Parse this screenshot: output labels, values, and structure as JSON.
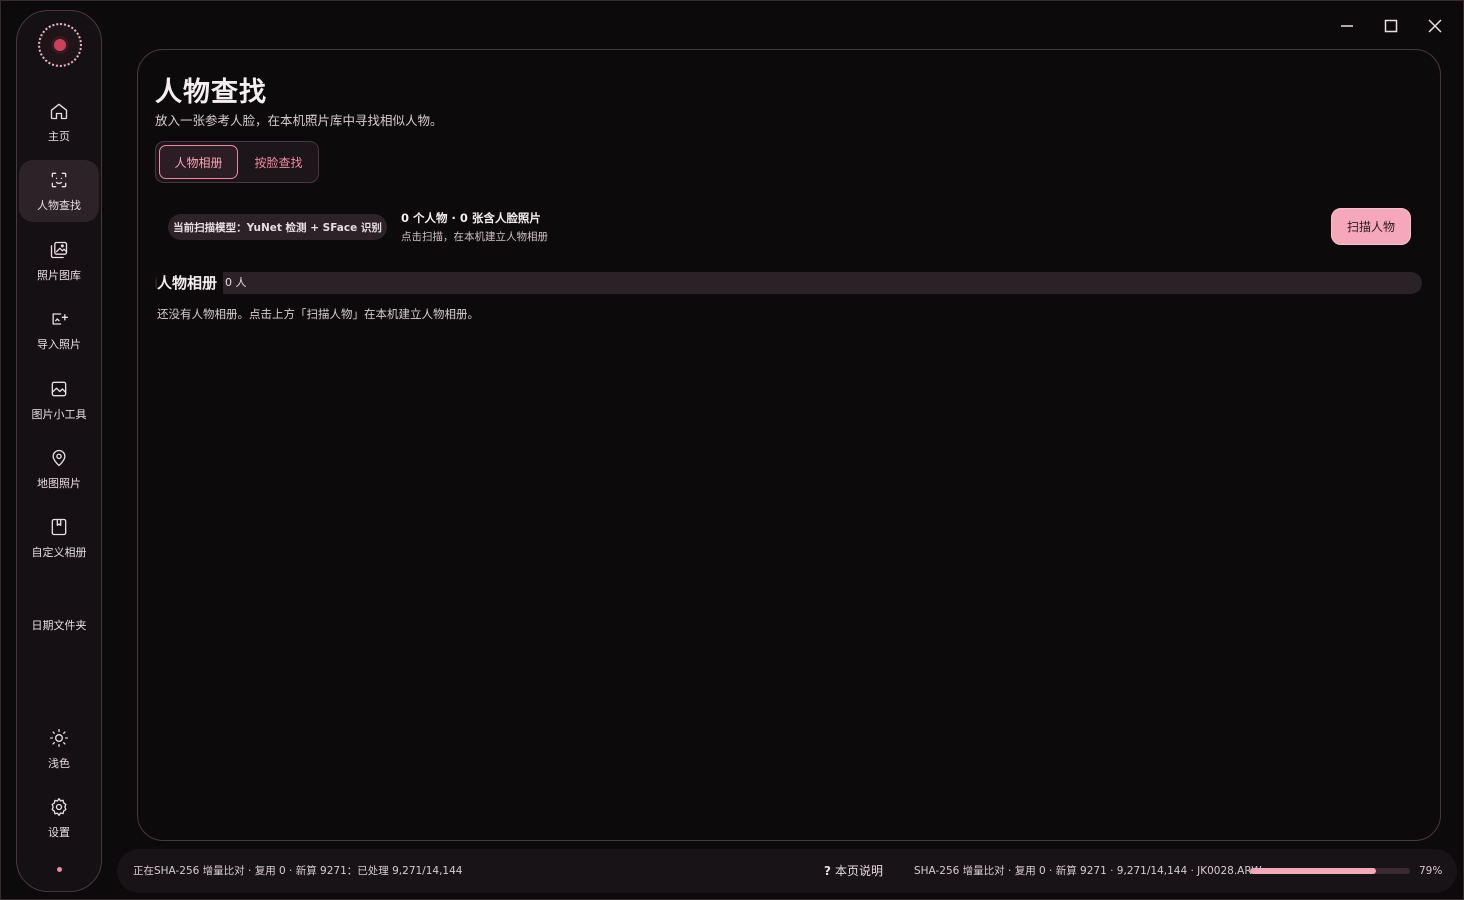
{
  "sidebar": {
    "items": [
      {
        "label": "主页",
        "icon": "home-icon"
      },
      {
        "label": "人物查找",
        "icon": "face-scan-icon",
        "active": true
      },
      {
        "label": "照片图库",
        "icon": "photo-library-icon"
      },
      {
        "label": "导入照片",
        "icon": "import-icon"
      },
      {
        "label": "图片小工具",
        "icon": "image-tools-icon"
      },
      {
        "label": "地图照片",
        "icon": "map-pin-icon"
      },
      {
        "label": "自定义相册",
        "icon": "album-icon"
      },
      {
        "label": "日期文件夹",
        "icon": ""
      }
    ],
    "bottom": [
      {
        "label": "浅色",
        "icon": "sun-icon"
      },
      {
        "label": "设置",
        "icon": "gear-icon"
      }
    ]
  },
  "page": {
    "title": "人物查找",
    "subtitle": "放入一张参考人脸，在本机照片库中寻找相似人物。"
  },
  "tabs": [
    {
      "label": "人物相册",
      "active": true
    },
    {
      "label": "按脸查找",
      "active": false
    }
  ],
  "scan": {
    "model_badge": "当前扫描模型：YuNet 检测 + SFace 识别",
    "stats_title": "0 个人物 · 0 张含人脸照片",
    "stats_sub": "点击扫描，在本机建立人物相册",
    "button": "扫描人物"
  },
  "album": {
    "title": "人物相册",
    "count": "0 人",
    "empty_message": "还没有人物相册。点击上方「扫描人物」在本机建立人物相册。"
  },
  "status": {
    "left": "正在SHA-256 增量比对 · 复用 0 · 新算 9271：已处理 9,271/14,144",
    "help": "本页说明",
    "help_mark": "?",
    "right": "SHA-256 增量比对 · 复用 0 · 新算 9271 · 9,271/14,144 · JK0028.ARW",
    "progress_percent": 79,
    "progress_label": "79%"
  },
  "colors": {
    "accent": "#f5a8ba",
    "accent_text": "#f08aa3",
    "background": "#0d0a0c",
    "border": "#4a3640"
  }
}
